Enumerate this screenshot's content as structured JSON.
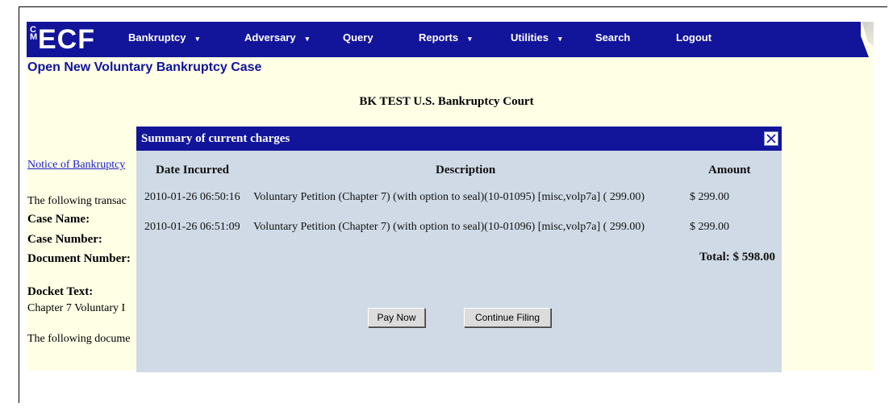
{
  "nav": {
    "logo_small": "CM",
    "logo_big": "ECF",
    "items": [
      {
        "label": "Bankruptcy",
        "caret": "▾"
      },
      {
        "label": "Adversary",
        "caret": "▾"
      },
      {
        "label": "Query",
        "caret": ""
      },
      {
        "label": "Reports",
        "caret": "▾"
      },
      {
        "label": "Utilities",
        "caret": "▾"
      },
      {
        "label": "Search",
        "caret": ""
      },
      {
        "label": "Logout",
        "caret": ""
      }
    ]
  },
  "page_title": "Open New Voluntary Bankruptcy Case",
  "court_name": "BK TEST U.S. Bankruptcy Court",
  "background": {
    "notice_link": "Notice of Bankruptcy",
    "transaction_text": "The following transac",
    "case_name_label": "Case Name:",
    "case_number_label": "Case Number:",
    "document_number_label": "Document Number:",
    "docket_text_label": "Docket Text:",
    "docket_text_value": "Chapter 7 Voluntary I",
    "document_text": "The following docume"
  },
  "modal": {
    "title": "Summary of current charges",
    "headers": {
      "date": "Date Incurred",
      "description": "Description",
      "amount": "Amount"
    },
    "rows": [
      {
        "date": "2010-01-26 06:50:16",
        "description": "Voluntary Petition (Chapter 7) (with option to seal)(10-01095) [misc,volp7a] ( 299.00)",
        "amount": "$ 299.00"
      },
      {
        "date": "2010-01-26 06:51:09",
        "description": "Voluntary Petition (Chapter 7) (with option to seal)(10-01096) [misc,volp7a] ( 299.00)",
        "amount": "$ 299.00"
      }
    ],
    "total": "Total: $ 598.00",
    "pay_now_label": "Pay Now",
    "continue_label": "Continue Filing"
  }
}
